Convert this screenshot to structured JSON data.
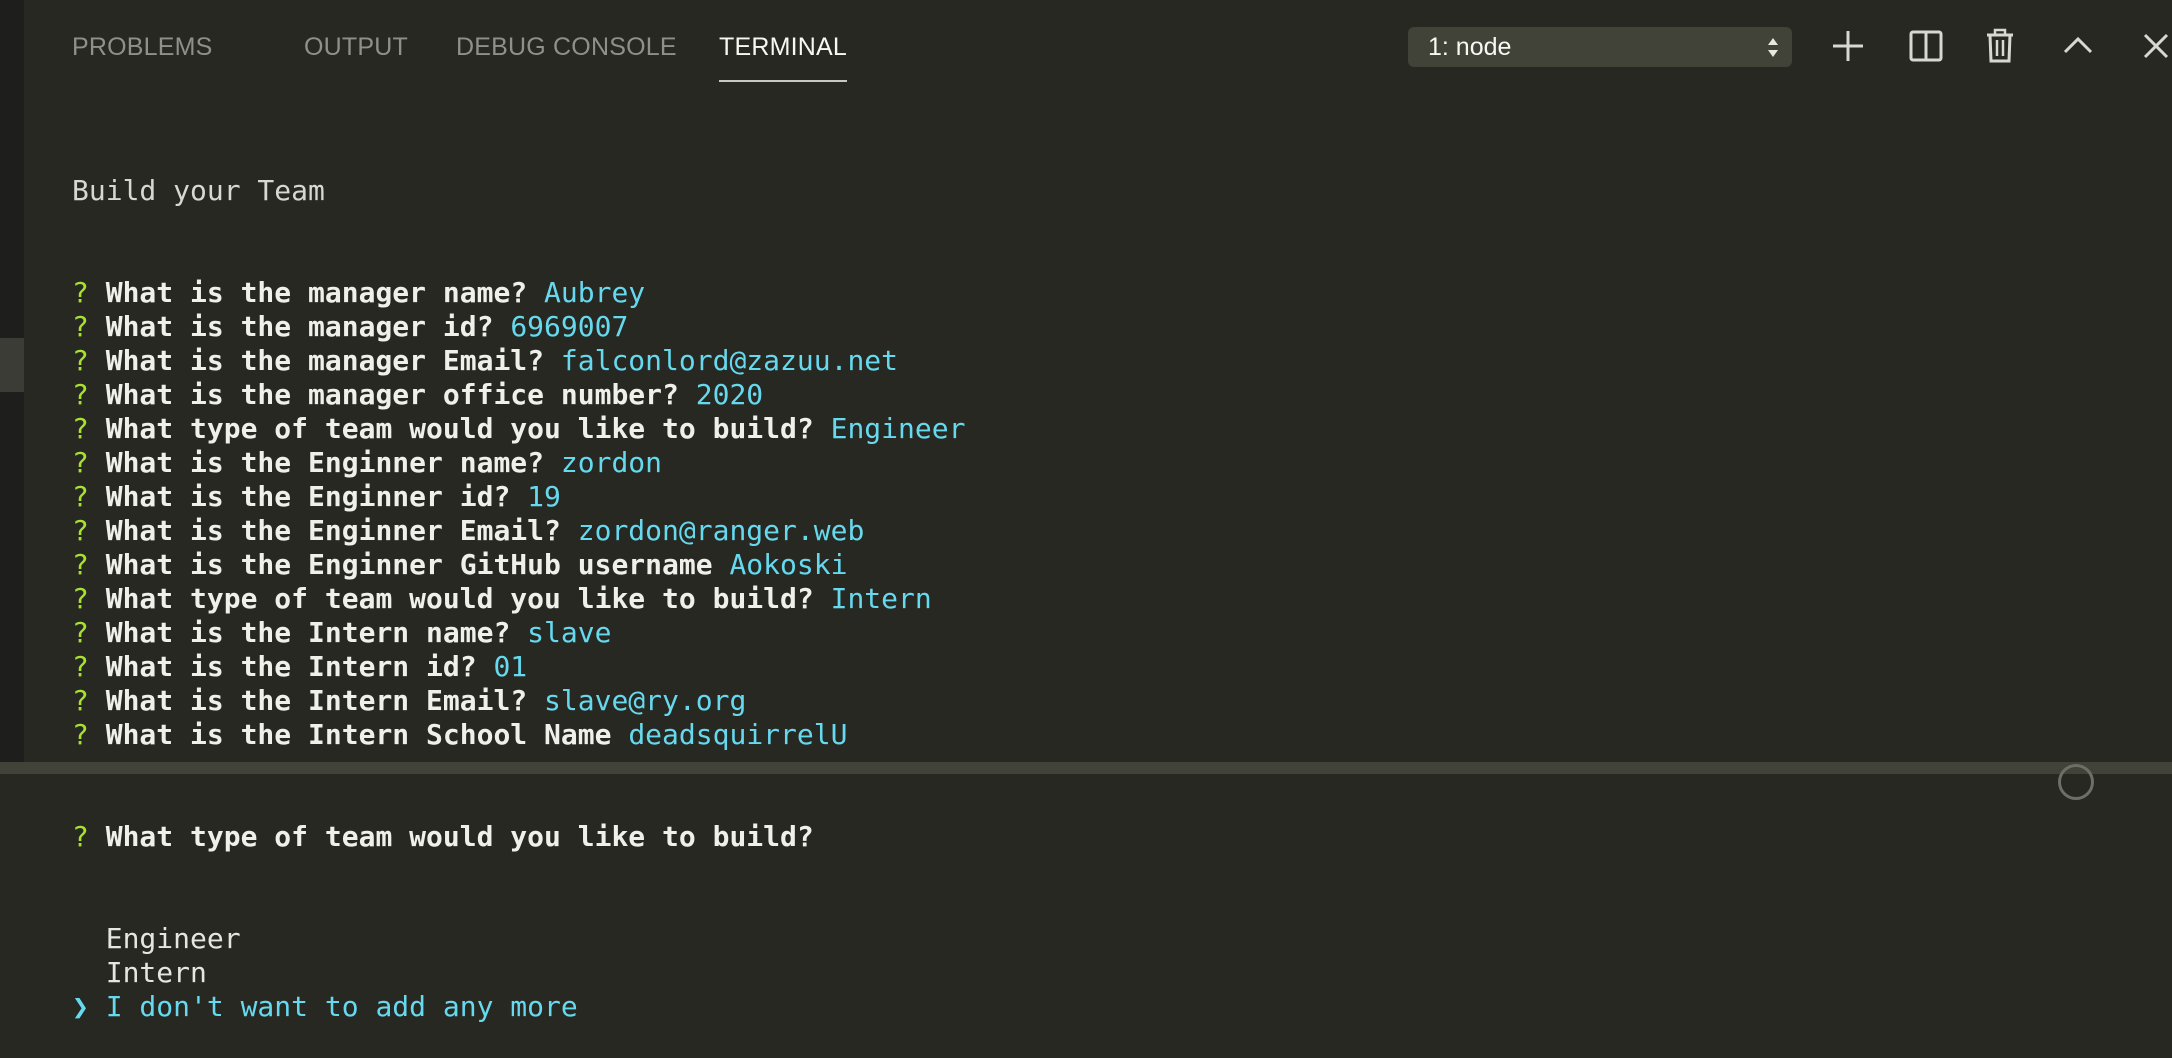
{
  "tabs": [
    {
      "label": "PROBLEMS",
      "active": false
    },
    {
      "label": "OUTPUT",
      "active": false
    },
    {
      "label": "DEBUG CONSOLE",
      "active": false
    },
    {
      "label": "TERMINAL",
      "active": true
    }
  ],
  "terminal_select": {
    "value": "1: node"
  },
  "toolbar_icons": [
    "plus-icon",
    "split-icon",
    "trash-icon",
    "chevron-up-icon",
    "close-icon"
  ],
  "terminal": {
    "heading": "Build your Team",
    "prompt_symbol": "?",
    "qa": [
      {
        "q": "What is the manager name?",
        "a": "Aubrey"
      },
      {
        "q": "What is the manager id?",
        "a": "6969007"
      },
      {
        "q": "What is the manager Email?",
        "a": "falconlord@zazuu.net"
      },
      {
        "q": "What is the manager office number?",
        "a": "2020"
      },
      {
        "q": "What type of team would you like to build?",
        "a": "Engineer"
      },
      {
        "q": "What is the Enginner name?",
        "a": "zordon"
      },
      {
        "q": "What is the Enginner id?",
        "a": "19"
      },
      {
        "q": "What is the Enginner Email?",
        "a": "zordon@ranger.web"
      },
      {
        "q": "What is the Enginner GitHub username",
        "a": "Aokoski"
      },
      {
        "q": "What type of team would you like to build?",
        "a": "Intern"
      },
      {
        "q": "What is the Intern name?",
        "a": "slave"
      },
      {
        "q": "What is the Intern id?",
        "a": "01"
      },
      {
        "q": "What is the Intern Email?",
        "a": "slave@ry.org"
      },
      {
        "q": "What is the Intern School Name",
        "a": "deadsquirrelU"
      }
    ],
    "current_question": "What type of team would you like to build?",
    "choices": [
      "Engineer",
      "Intern",
      "I don't want to add any more"
    ],
    "selected_index": 2,
    "pointer_symbol": "❯"
  },
  "colors": {
    "background": "#272822",
    "prompt_q": "#a6e22e",
    "answer": "#66d9ef",
    "select_bg": "#414339"
  }
}
